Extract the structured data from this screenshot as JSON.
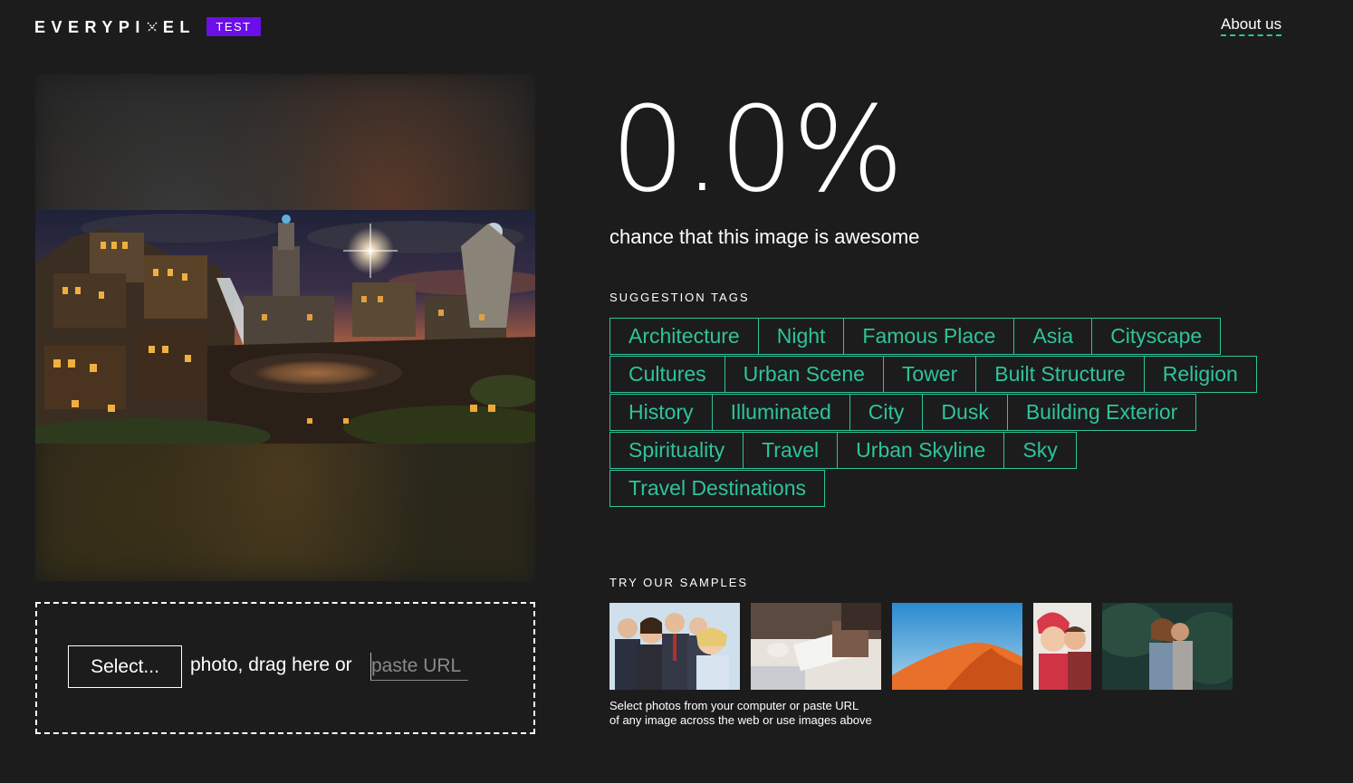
{
  "header": {
    "logo": "EVERYPIXEL",
    "logo_before_mark": "EVERYPI",
    "logo_after_mark": "EL",
    "badge": "TEST",
    "about_link": "About us"
  },
  "result": {
    "score": "0.0%",
    "subtitle": "chance that this image is awesome"
  },
  "tags_section": {
    "title": "SUGGESTION TAGS",
    "rows": [
      [
        "Architecture",
        "Night",
        "Famous Place",
        "Asia",
        "Cityscape"
      ],
      [
        "Cultures",
        "Urban Scene",
        "Tower",
        "Built Structure",
        "Religion"
      ],
      [
        "History",
        "Illuminated",
        "City",
        "Dusk",
        "Building Exterior"
      ],
      [
        "Spirituality",
        "Travel",
        "Urban Skyline",
        "Sky"
      ],
      [
        "Travel Destinations"
      ]
    ]
  },
  "upload": {
    "select_button": "Select...",
    "drop_text": "photo, drag here or",
    "url_placeholder": "paste URL"
  },
  "samples_section": {
    "title": "TRY OUR SAMPLES",
    "help_line1": "Select photos from your computer or paste URL",
    "help_line2": "of any image across the web or use images above"
  },
  "colors": {
    "background": "#1c1c1c",
    "accent": "#2ec49a",
    "badge": "#6a0fe6"
  }
}
